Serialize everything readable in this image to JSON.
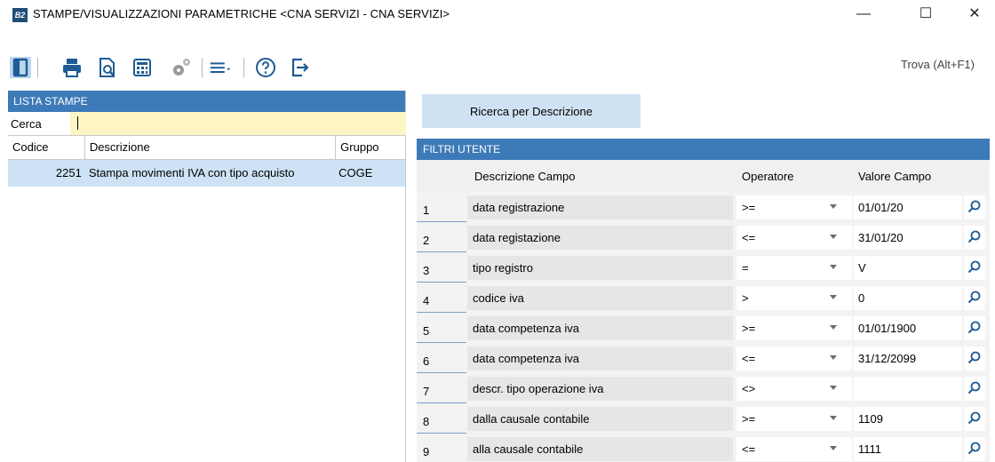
{
  "window": {
    "app_logo": "B2",
    "title": "STAMPE/VISUALIZZAZIONI PARAMETRICHE <CNA SERVIZI - CNA SERVIZI>",
    "minimize": "—",
    "maximize": "☐",
    "close": "✕"
  },
  "toolbar": {
    "icons": [
      "panel-toggle-icon",
      "print-icon",
      "print-preview-icon",
      "calculator-icon",
      "settings-gears-icon",
      "menu-icon",
      "help-icon",
      "exit-icon"
    ],
    "find_label": "Trova (Alt+F1)"
  },
  "left_panel": {
    "header": "LISTA STAMPE",
    "search_label": "Cerca",
    "search_value": "",
    "columns": [
      "Codice",
      "Descrizione",
      "Gruppo"
    ],
    "rows": [
      {
        "code": "2251",
        "description": "Stampa movimenti IVA con tipo acquisto",
        "group": "COGE"
      }
    ]
  },
  "right_panel": {
    "search_button": "Ricerca per Descrizione",
    "filters_header": "FILTRI UTENTE",
    "columns": {
      "desc": "Descrizione Campo",
      "op": "Operatore",
      "val": "Valore Campo"
    },
    "rows": [
      {
        "n": "1",
        "desc": "data registrazione",
        "op": ">=",
        "val": "01/01/20"
      },
      {
        "n": "2",
        "desc": "data registazione",
        "op": "<=",
        "val": "31/01/20"
      },
      {
        "n": "3",
        "desc": "tipo registro",
        "op": "=",
        "val": "V"
      },
      {
        "n": "4",
        "desc": "codice iva",
        "op": ">",
        "val": "0"
      },
      {
        "n": "5",
        "desc": "data competenza iva",
        "op": ">=",
        "val": "01/01/1900"
      },
      {
        "n": "6",
        "desc": "data competenza iva",
        "op": "<=",
        "val": "31/12/2099"
      },
      {
        "n": "7",
        "desc": "descr. tipo operazione iva",
        "op": "<>",
        "val": ""
      },
      {
        "n": "8",
        "desc": "dalla causale contabile",
        "op": ">=",
        "val": "1109"
      },
      {
        "n": "9",
        "desc": "alla causale contabile",
        "op": "<=",
        "val": "1111"
      }
    ]
  },
  "colors": {
    "header_blue": "#3d7ab8",
    "selection_blue": "#cde3f5",
    "search_yellow": "#fdf5c4",
    "button_blue": "#cfe2f3"
  }
}
